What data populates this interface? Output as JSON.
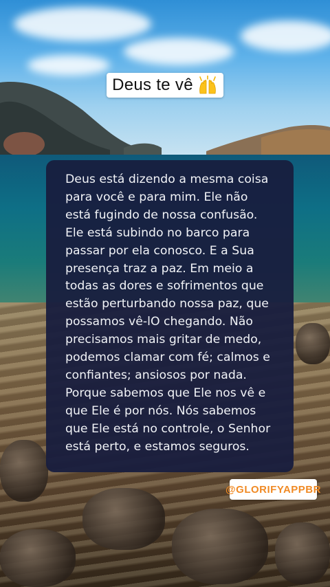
{
  "header": {
    "title": "Deus te vê",
    "title_icon": "raising-hands-icon"
  },
  "quote": {
    "lines": [
      "Deus está dizendo a mesma coisa",
      "para você e para mim. Ele não",
      "está fugindo de nossa confusão.",
      "Ele está subindo no barco para",
      "passar por ela conosco. E a Sua",
      "presença traz a paz. Em meio a",
      "todas as dores e sofrimentos que",
      "estão perturbando nossa paz, que",
      "possamos vê-lO chegando. Não",
      "precisamos mais gritar de medo,",
      "podemos clamar com fé; calmos e",
      "confiantes; ansiosos por nada.",
      "Porque sabemos que Ele nos vê e",
      "que Ele é por nós. Nós sabemos",
      "que Ele está no controle, o Senhor",
      "está perto, e estamos seguros."
    ]
  },
  "footer": {
    "handle": "@GLORIFYAPPBR"
  },
  "colors": {
    "card_background": "#181e3e",
    "card_text": "#f1f3f7",
    "handle_accent": "#f08a24",
    "title_background": "#ffffff"
  }
}
